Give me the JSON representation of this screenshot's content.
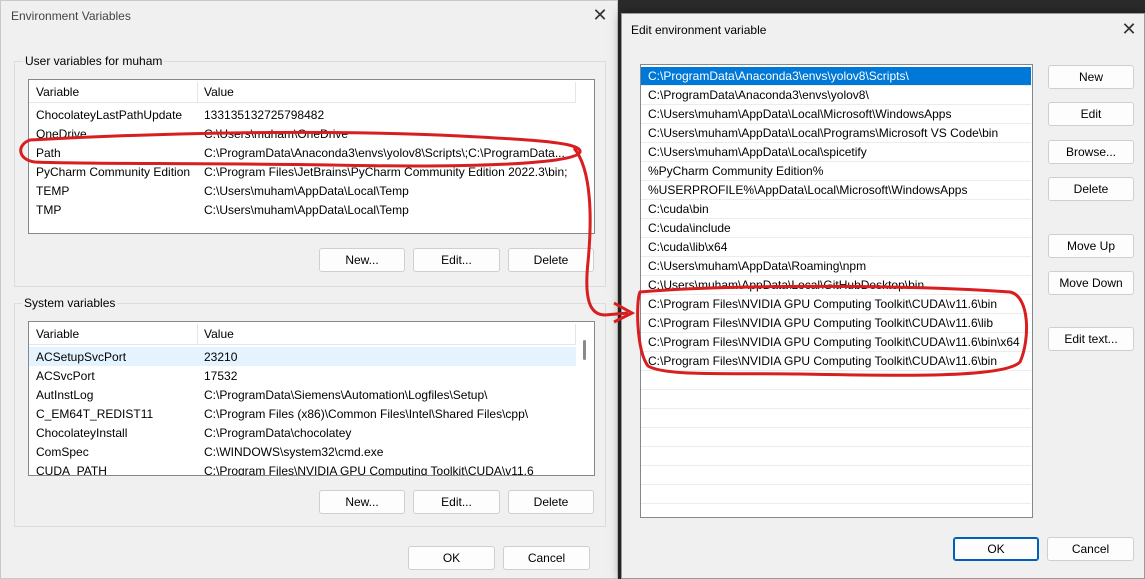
{
  "env_window": {
    "title": "Environment Variables",
    "close": "✕",
    "user_group": {
      "label": "User variables for muham",
      "columns": [
        "Variable",
        "Value"
      ],
      "rows": [
        {
          "variable": "ChocolateyLastPathUpdate",
          "value": "133135132725798482"
        },
        {
          "variable": "OneDrive",
          "value": "C:\\Users\\muham\\OneDrive"
        },
        {
          "variable": "Path",
          "value": "C:\\ProgramData\\Anaconda3\\envs\\yolov8\\Scripts\\;C:\\ProgramData..."
        },
        {
          "variable": "PyCharm Community Edition",
          "value": "C:\\Program Files\\JetBrains\\PyCharm Community Edition 2022.3\\bin;"
        },
        {
          "variable": "TEMP",
          "value": "C:\\Users\\muham\\AppData\\Local\\Temp"
        },
        {
          "variable": "TMP",
          "value": "C:\\Users\\muham\\AppData\\Local\\Temp"
        }
      ],
      "new_label": "New...",
      "edit_label": "Edit...",
      "delete_label": "Delete"
    },
    "system_group": {
      "label": "System variables",
      "columns": [
        "Variable",
        "Value"
      ],
      "rows": [
        {
          "variable": "ACSetupSvcPort",
          "value": "23210"
        },
        {
          "variable": "ACSvcPort",
          "value": "17532"
        },
        {
          "variable": "AutInstLog",
          "value": "C:\\ProgramData\\Siemens\\Automation\\Logfiles\\Setup\\"
        },
        {
          "variable": "C_EM64T_REDIST11",
          "value": "C:\\Program Files (x86)\\Common Files\\Intel\\Shared Files\\cpp\\"
        },
        {
          "variable": "ChocolateyInstall",
          "value": "C:\\ProgramData\\chocolatey"
        },
        {
          "variable": "ComSpec",
          "value": "C:\\WINDOWS\\system32\\cmd.exe"
        },
        {
          "variable": "CUDA_PATH",
          "value": "C:\\Program Files\\NVIDIA GPU Computing Toolkit\\CUDA\\v11.6"
        }
      ],
      "new_label": "New...",
      "edit_label": "Edit...",
      "delete_label": "Delete"
    },
    "ok_label": "OK",
    "cancel_label": "Cancel"
  },
  "edit_window": {
    "title": "Edit environment variable",
    "close": "✕",
    "entries": [
      "C:\\ProgramData\\Anaconda3\\envs\\yolov8\\Scripts\\",
      "C:\\ProgramData\\Anaconda3\\envs\\yolov8\\",
      "C:\\Users\\muham\\AppData\\Local\\Microsoft\\WindowsApps",
      "C:\\Users\\muham\\AppData\\Local\\Programs\\Microsoft VS Code\\bin",
      "C:\\Users\\muham\\AppData\\Local\\spicetify",
      "%PyCharm Community Edition%",
      "%USERPROFILE%\\AppData\\Local\\Microsoft\\WindowsApps",
      "C:\\cuda\\bin",
      "C:\\cuda\\include",
      "C:\\cuda\\lib\\x64",
      "C:\\Users\\muham\\AppData\\Roaming\\npm",
      "C:\\Users\\muham\\AppData\\Local\\GitHubDesktop\\bin",
      "C:\\Program Files\\NVIDIA GPU Computing Toolkit\\CUDA\\v11.6\\bin",
      "C:\\Program Files\\NVIDIA GPU Computing Toolkit\\CUDA\\v11.6\\lib",
      "C:\\Program Files\\NVIDIA GPU Computing Toolkit\\CUDA\\v11.6\\bin\\x64",
      "C:\\Program Files\\NVIDIA GPU Computing Toolkit\\CUDA\\v11.6\\bin"
    ],
    "selected_index": 0,
    "buttons": {
      "new": "New",
      "edit": "Edit",
      "browse": "Browse...",
      "delete": "Delete",
      "move_up": "Move Up",
      "move_down": "Move Down",
      "edit_text": "Edit text..."
    },
    "ok_label": "OK",
    "cancel_label": "Cancel"
  },
  "colors": {
    "selection": "#0078d7",
    "annotation": "#d81e1e"
  }
}
